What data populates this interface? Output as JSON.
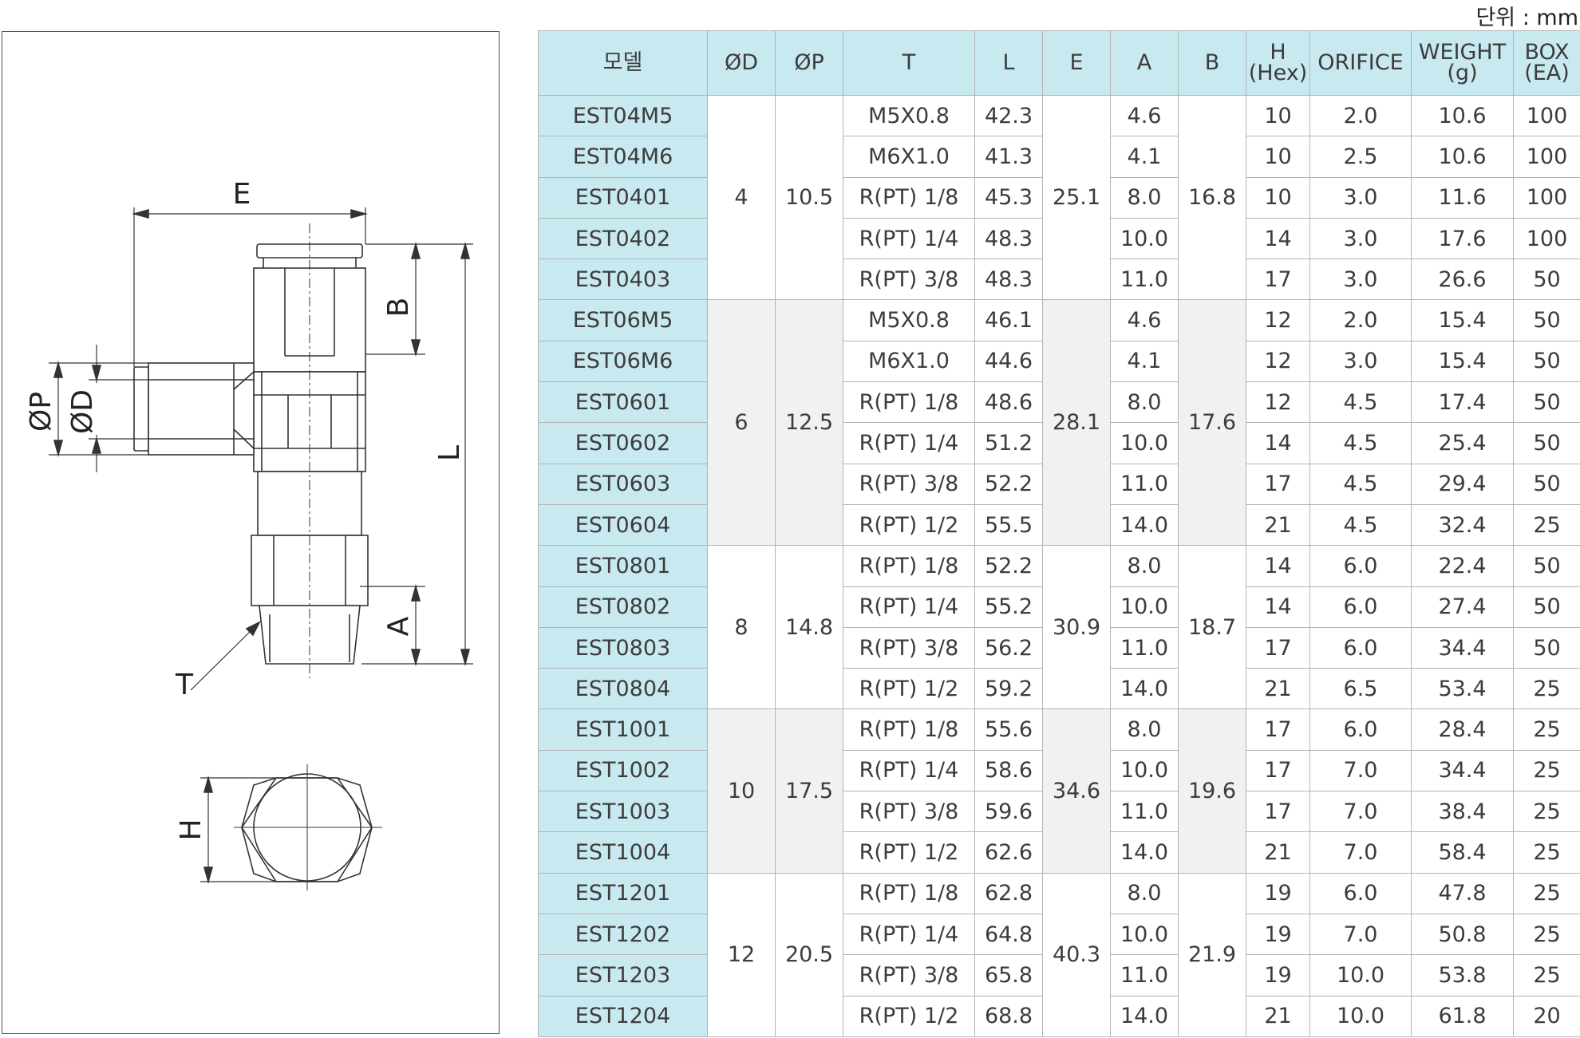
{
  "unit_label": "단위 : mm",
  "drawing": {
    "labels": {
      "E": "E",
      "B": "B",
      "L": "L",
      "P": "ØP",
      "D": "ØD",
      "A": "A",
      "T": "T",
      "H": "H"
    }
  },
  "table": {
    "headers": {
      "model": "모델",
      "od": "ØD",
      "op": "ØP",
      "t": "T",
      "l": "L",
      "e": "E",
      "a": "A",
      "b": "B",
      "h_line1": "H",
      "h_line2": "(Hex)",
      "orifice": "ORIFICE",
      "weight_line1": "WEIGHT",
      "weight_line2": "(g)",
      "box_line1": "BOX",
      "box_line2": "(EA)"
    },
    "groups": [
      {
        "od": "4",
        "op": "10.5",
        "e": "25.1",
        "b": "16.8",
        "rows": [
          {
            "model": "EST04M5",
            "t": "M5X0.8",
            "l": "42.3",
            "a": "4.6",
            "h": "10",
            "orifice": "2.0",
            "weight": "10.6",
            "box": "100"
          },
          {
            "model": "EST04M6",
            "t": "M6X1.0",
            "l": "41.3",
            "a": "4.1",
            "h": "10",
            "orifice": "2.5",
            "weight": "10.6",
            "box": "100"
          },
          {
            "model": "EST0401",
            "t": "R(PT) 1/8",
            "l": "45.3",
            "a": "8.0",
            "h": "10",
            "orifice": "3.0",
            "weight": "11.6",
            "box": "100"
          },
          {
            "model": "EST0402",
            "t": "R(PT) 1/4",
            "l": "48.3",
            "a": "10.0",
            "h": "14",
            "orifice": "3.0",
            "weight": "17.6",
            "box": "100"
          },
          {
            "model": "EST0403",
            "t": "R(PT) 3/8",
            "l": "48.3",
            "a": "11.0",
            "h": "17",
            "orifice": "3.0",
            "weight": "26.6",
            "box": "50"
          }
        ]
      },
      {
        "od": "6",
        "op": "12.5",
        "e": "28.1",
        "b": "17.6",
        "rows": [
          {
            "model": "EST06M5",
            "t": "M5X0.8",
            "l": "46.1",
            "a": "4.6",
            "h": "12",
            "orifice": "2.0",
            "weight": "15.4",
            "box": "50"
          },
          {
            "model": "EST06M6",
            "t": "M6X1.0",
            "l": "44.6",
            "a": "4.1",
            "h": "12",
            "orifice": "3.0",
            "weight": "15.4",
            "box": "50"
          },
          {
            "model": "EST0601",
            "t": "R(PT) 1/8",
            "l": "48.6",
            "a": "8.0",
            "h": "12",
            "orifice": "4.5",
            "weight": "17.4",
            "box": "50"
          },
          {
            "model": "EST0602",
            "t": "R(PT) 1/4",
            "l": "51.2",
            "a": "10.0",
            "h": "14",
            "orifice": "4.5",
            "weight": "25.4",
            "box": "50"
          },
          {
            "model": "EST0603",
            "t": "R(PT) 3/8",
            "l": "52.2",
            "a": "11.0",
            "h": "17",
            "orifice": "4.5",
            "weight": "29.4",
            "box": "50"
          },
          {
            "model": "EST0604",
            "t": "R(PT) 1/2",
            "l": "55.5",
            "a": "14.0",
            "h": "21",
            "orifice": "4.5",
            "weight": "32.4",
            "box": "25"
          }
        ]
      },
      {
        "od": "8",
        "op": "14.8",
        "e": "30.9",
        "b": "18.7",
        "rows": [
          {
            "model": "EST0801",
            "t": "R(PT) 1/8",
            "l": "52.2",
            "a": "8.0",
            "h": "14",
            "orifice": "6.0",
            "weight": "22.4",
            "box": "50"
          },
          {
            "model": "EST0802",
            "t": "R(PT) 1/4",
            "l": "55.2",
            "a": "10.0",
            "h": "14",
            "orifice": "6.0",
            "weight": "27.4",
            "box": "50"
          },
          {
            "model": "EST0803",
            "t": "R(PT) 3/8",
            "l": "56.2",
            "a": "11.0",
            "h": "17",
            "orifice": "6.0",
            "weight": "34.4",
            "box": "50"
          },
          {
            "model": "EST0804",
            "t": "R(PT) 1/2",
            "l": "59.2",
            "a": "14.0",
            "h": "21",
            "orifice": "6.5",
            "weight": "53.4",
            "box": "25"
          }
        ]
      },
      {
        "od": "10",
        "op": "17.5",
        "e": "34.6",
        "b": "19.6",
        "rows": [
          {
            "model": "EST1001",
            "t": "R(PT) 1/8",
            "l": "55.6",
            "a": "8.0",
            "h": "17",
            "orifice": "6.0",
            "weight": "28.4",
            "box": "25"
          },
          {
            "model": "EST1002",
            "t": "R(PT) 1/4",
            "l": "58.6",
            "a": "10.0",
            "h": "17",
            "orifice": "7.0",
            "weight": "34.4",
            "box": "25"
          },
          {
            "model": "EST1003",
            "t": "R(PT) 3/8",
            "l": "59.6",
            "a": "11.0",
            "h": "17",
            "orifice": "7.0",
            "weight": "38.4",
            "box": "25"
          },
          {
            "model": "EST1004",
            "t": "R(PT) 1/2",
            "l": "62.6",
            "a": "14.0",
            "h": "21",
            "orifice": "7.0",
            "weight": "58.4",
            "box": "25"
          }
        ]
      },
      {
        "od": "12",
        "op": "20.5",
        "e": "40.3",
        "b": "21.9",
        "rows": [
          {
            "model": "EST1201",
            "t": "R(PT) 1/8",
            "l": "62.8",
            "a": "8.0",
            "h": "19",
            "orifice": "6.0",
            "weight": "47.8",
            "box": "25"
          },
          {
            "model": "EST1202",
            "t": "R(PT) 1/4",
            "l": "64.8",
            "a": "10.0",
            "h": "19",
            "orifice": "7.0",
            "weight": "50.8",
            "box": "25"
          },
          {
            "model": "EST1203",
            "t": "R(PT) 3/8",
            "l": "65.8",
            "a": "11.0",
            "h": "19",
            "orifice": "10.0",
            "weight": "53.8",
            "box": "25"
          },
          {
            "model": "EST1204",
            "t": "R(PT) 1/2",
            "l": "68.8",
            "a": "14.0",
            "h": "21",
            "orifice": "10.0",
            "weight": "61.8",
            "box": "20"
          }
        ]
      }
    ]
  }
}
